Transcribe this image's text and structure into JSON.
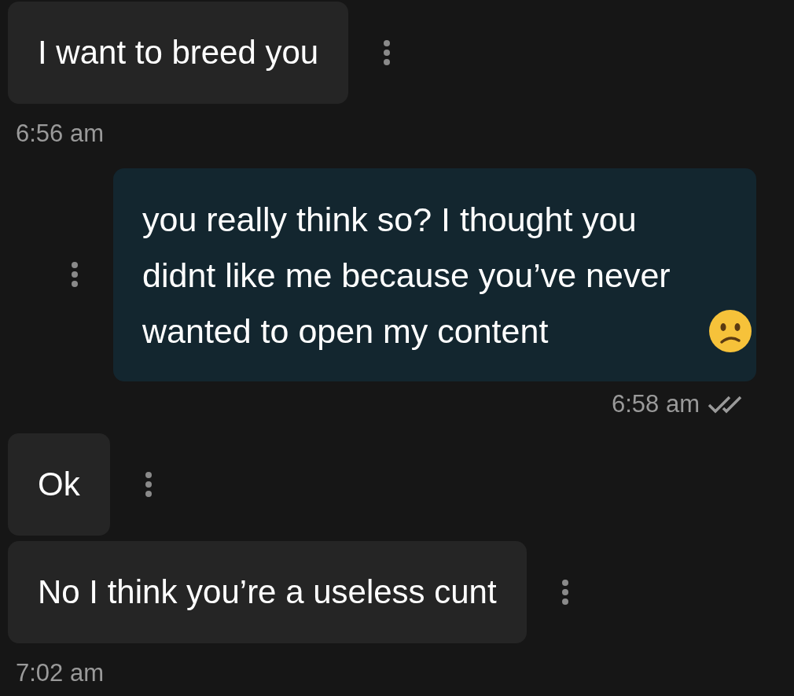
{
  "messages": [
    {
      "kind": "incoming",
      "text": "I want to breed you",
      "time": "6:56 am"
    },
    {
      "kind": "outgoing",
      "text": "you really think so? I thought you didnt like me because you’ve never wanted to open my content",
      "time": "6:58 am",
      "read": true
    },
    {
      "kind": "incoming",
      "text": "Ok"
    },
    {
      "kind": "incoming",
      "text": "No I think you’re a useless cunt",
      "time": "7:02 am"
    }
  ]
}
